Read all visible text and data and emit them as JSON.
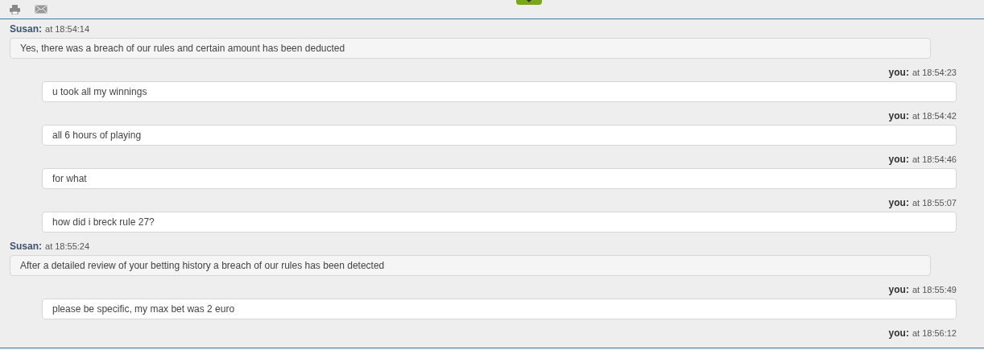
{
  "messages": [
    {
      "kind": "agent",
      "author": "Susan:",
      "time": "at 18:54:14",
      "text": "Yes, there was a breach of our rules and certain amount has been deducted"
    },
    {
      "kind": "user",
      "author": "you:",
      "time": "at 18:54:23",
      "text": "u took all my winnings"
    },
    {
      "kind": "user",
      "author": "you:",
      "time": "at 18:54:42",
      "text": "all 6 hours of playing"
    },
    {
      "kind": "user",
      "author": "you:",
      "time": "at 18:54:46",
      "text": "for what"
    },
    {
      "kind": "user",
      "author": "you:",
      "time": "at 18:55:07",
      "text": "how did i breck rule 27?"
    },
    {
      "kind": "agent",
      "author": "Susan:",
      "time": "at 18:55:24",
      "text": "After a detailed review of your betting history a breach of our rules has been detected"
    },
    {
      "kind": "user",
      "author": "you:",
      "time": "at 18:55:49",
      "text": "please be specific, my max bet was 2 euro"
    },
    {
      "kind": "user",
      "author": "you:",
      "time": "at 18:56:12"
    }
  ]
}
